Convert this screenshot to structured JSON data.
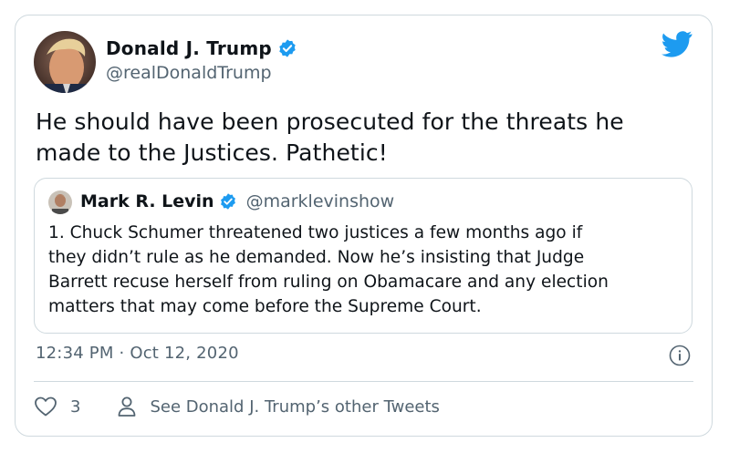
{
  "author": {
    "display_name": "Donald J. Trump",
    "handle": "@realDonaldTrump",
    "verified": true
  },
  "tweet": {
    "text_line1": "He should have been prosecuted for the threats he",
    "text_line2": "made to the Justices. Pathetic!",
    "timestamp": "12:34 PM · Oct 12, 2020"
  },
  "quoted": {
    "display_name": "Mark R. Levin",
    "handle": "@marklevinshow",
    "verified": true,
    "line1": "1. Chuck Schumer threatened two justices a few months ago if",
    "line2": "they didn’t rule as he demanded. Now he’s insisting that Judge",
    "line3": "Barrett recuse herself from ruling on Obamacare and any election",
    "line4": "matters that may come before the Supreme Court."
  },
  "actions": {
    "like_count": "3",
    "other_tweets_label": "See Donald J. Trump’s other Tweets"
  },
  "colors": {
    "brand": "#1d9bf0",
    "text": "#0f1419",
    "secondary": "#536471",
    "border": "#cfd9de"
  },
  "icons": [
    "twitter-bird-icon",
    "verified-badge-icon",
    "info-icon",
    "heart-icon",
    "person-icon"
  ]
}
